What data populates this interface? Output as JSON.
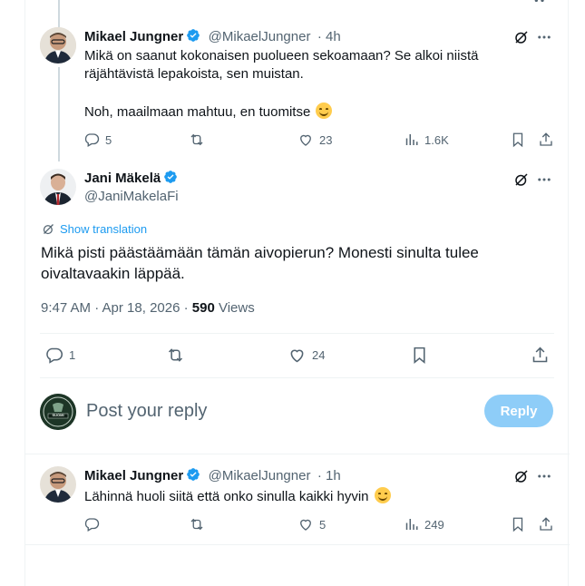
{
  "reply1": {
    "author_name": "Mikael Jungner",
    "author_handle": "@MikaelJungner",
    "time": "· 4h",
    "text_line1": "Mikä on saanut kokonaisen puolueen sekoamaan? Se alkoi niistä",
    "text_line2": "räjähtävistä lepakoista, sen muistan.",
    "text_line3": "Noh, maailmaan mahtuu, en tuomitse",
    "replies": "5",
    "likes": "23",
    "views": "1.6K"
  },
  "main_post": {
    "author_name": "Jani Mäkelä",
    "author_handle": "@JaniMakelaFi",
    "show_translation": "Show translation",
    "text_line1": "Mikä pisti päästäämään tämän aivopierun? Monesti sinulta tulee",
    "text_line2": "oivaltavaakin läppää.",
    "timestamp": "9:47 AM · Apr 18, 2026 ·",
    "views_count": "590",
    "views_label": "Views",
    "replies": "1",
    "likes": "24"
  },
  "composer": {
    "placeholder": "Post your reply",
    "button_label": "Reply",
    "avatar_text": "SUOMI"
  },
  "reply2": {
    "author_name": "Mikael Jungner",
    "author_handle": "@MikaelJungner",
    "time": "· 1h",
    "text": "Lähinnä huoli siitä että onko sinulla kaikki hyvin",
    "likes": "5",
    "views": "249"
  },
  "colors": {
    "accent": "#1d9bf0",
    "muted": "#536471",
    "reply_button_disabled": "#8ecdf8",
    "verified": "#1d9bf0"
  }
}
